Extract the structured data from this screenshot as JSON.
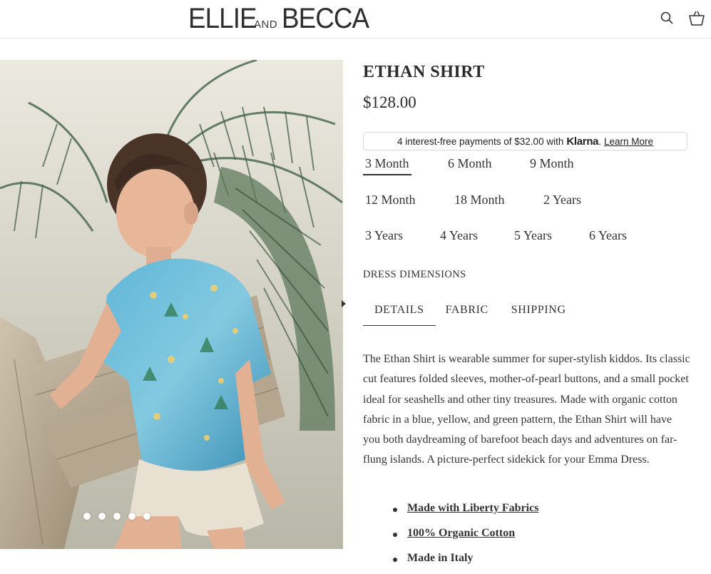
{
  "header": {
    "logo_part1": "ELLIE",
    "logo_part2": "AND",
    "logo_part3": "BECCA",
    "icons": [
      "search-icon",
      "cart-icon"
    ]
  },
  "product": {
    "title": "ETHAN SHIRT",
    "price": "$128.00",
    "klarna": {
      "text": "4 interest-free payments of $32.00 with",
      "brand": "Klarna",
      "period": ".",
      "learn_more": "Learn More"
    },
    "sizes": {
      "row1": [
        "3 Month",
        "6 Month",
        "9 Month"
      ],
      "row2": [
        "12 Month",
        "18 Month",
        "2 Years"
      ],
      "row3": [
        "3 Years",
        "4 Years",
        "5 Years",
        "6 Years"
      ],
      "selected": "3 Month"
    },
    "dimensions_link": "DRESS DIMENSIONS",
    "tabs": [
      "DETAILS",
      "FABRIC",
      "SHIPPING"
    ],
    "active_tab": "DETAILS",
    "description": "The Ethan Shirt is wearable summer for super-stylish kiddos. Its classic cut features folded sleeves, mother-of-pearl buttons, and a small pocket ideal for seashells and other tiny treasures. Made with organic cotton fabric in a blue, yellow, and green pattern, the Ethan Shirt will have you both daydreaming of barefoot beach days and adventures on far-flung islands. A picture-perfect sidekick for your Emma Dress.",
    "features": [
      "Made with Liberty Fabrics",
      "100% Organic Cotton",
      "Made in Italy"
    ]
  },
  "carousel": {
    "slide_count": 5
  },
  "colors": {
    "text": "#2b2b2b",
    "border": "#d8d8d8"
  }
}
